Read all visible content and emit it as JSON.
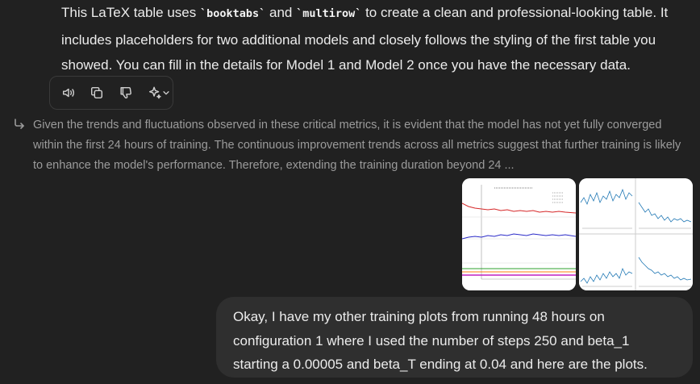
{
  "assistant_message": {
    "t1": "This LaTeX table uses ",
    "code1": "`booktabs`",
    "t2": " and ",
    "code2": "`multirow`",
    "t3": " to create a clean and professional-looking table. It includes placeholders for two additional models and closely follows the styling of the first table you showed. You can fill in the details for Model 1 and Model 2 once you have the necessary data."
  },
  "actions": {
    "icons": [
      "speaker-icon",
      "copy-icon",
      "thumbs-down-icon",
      "sparkle-icon",
      "chevron-down-icon"
    ]
  },
  "reply_quote": {
    "text": "Given the trends and fluctuations observed in these critical metrics, it is evident that the model has not yet fully converged within the first 24 hours of training. The continuous improvement trends across all metrics suggest that further training is likely to enhance the model's performance. Therefore, extending the training duration beyond 24 ..."
  },
  "attachments": {
    "count": 2
  },
  "user_message": {
    "text": "Okay, I have my other training plots from running 48 hours on configuration 1 where I used the number of steps 250 and beta_1 starting a 0.00005 and beta_T ending at 0.04 and here are the plots."
  },
  "colors": {
    "background": "#212121",
    "bubble": "#2f2f2f",
    "text": "#ececec",
    "muted": "#9b9b9b"
  }
}
